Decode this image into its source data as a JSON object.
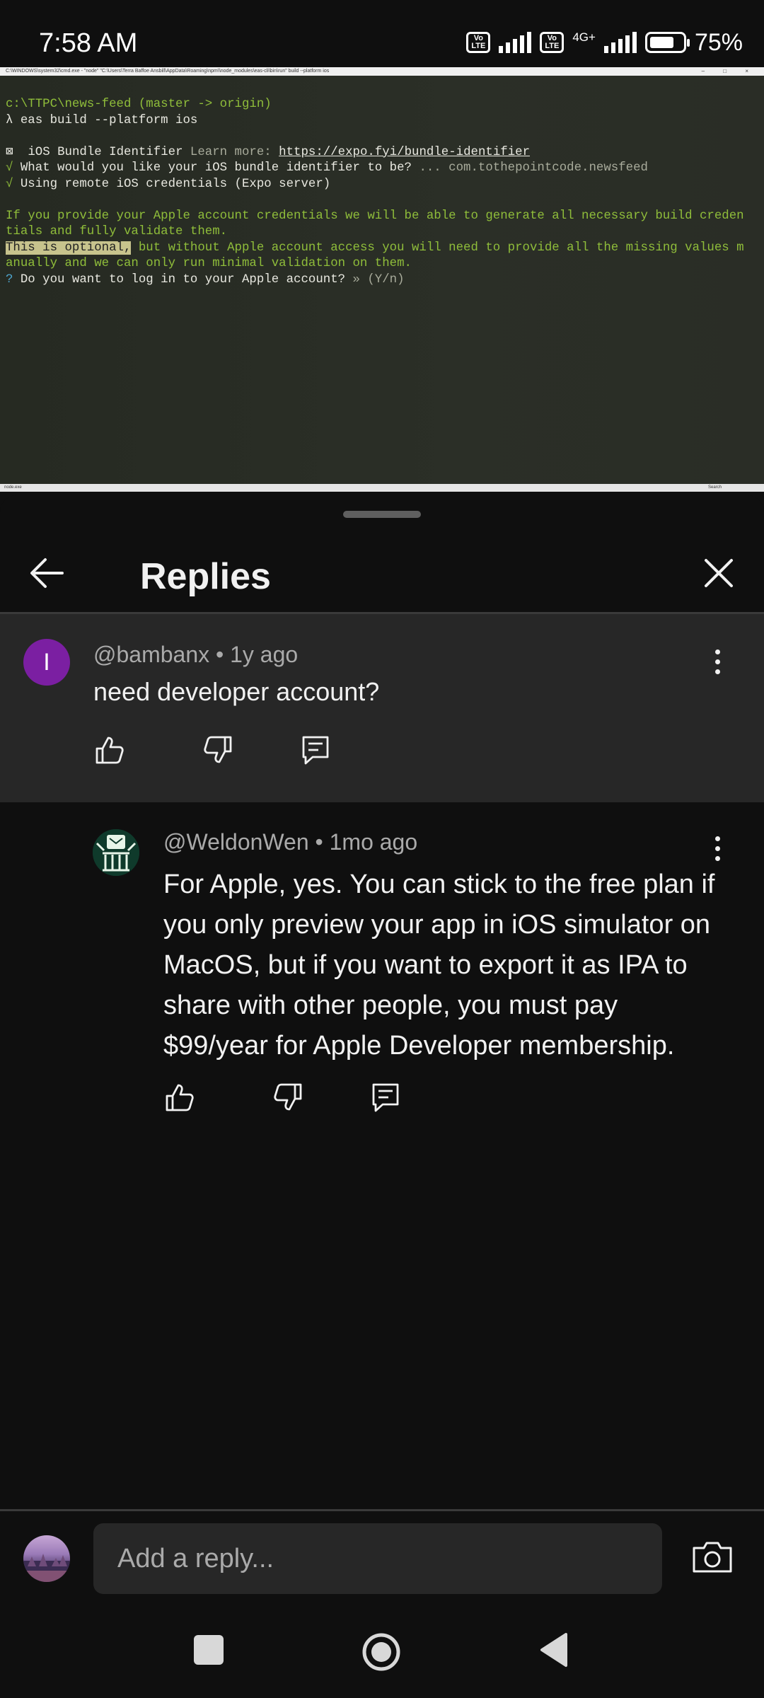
{
  "status_bar": {
    "time": "7:58 AM",
    "volte_1": "Vo LTE",
    "volte_2": "Vo LTE",
    "network": "4G+",
    "battery_percent": 75,
    "battery_text": "75%"
  },
  "terminal": {
    "title": "C:\\WINDOWS\\system32\\cmd.exe - \"node\" \"C:\\Users\\Terra Baffoe Ansbill\\AppData\\Roaming\\npm\\\\node_modules\\eas-cli\\bin\\run\" build --platform ios",
    "window_controls": "– □ ×",
    "prompt_path": "c:\\TTPC\\news-feed (master -> origin)",
    "command": "λ eas build --platform ios",
    "bundle_label": "⊠  iOS Bundle Identifier",
    "learn_more": " Learn more: ",
    "learn_more_link": "https://expo.fyi/bundle-identifier",
    "q1_check": "√",
    "q1_text": " What would you like your iOS bundle identifier to be? ",
    "q1_answer": "... com.tothepointcode.newsfeed",
    "q2_check": "√",
    "q2_text": " Using remote iOS credentials (Expo server)",
    "info_line1": "If you provide your Apple account credentials we will be able to generate all necessary build creden",
    "info_line2": "tials and fully validate them.",
    "optional_hl": "This is optional,",
    "optional_rest": " but without Apple account access you will need to provide all the missing values m",
    "optional_line2": "anually and we can only run minimal validation on them.",
    "q3_mark": "?",
    "q3_text": " Do you want to log in to your Apple account? ",
    "q3_hint": "» (Y/n)",
    "statusbar_left": "node.exe",
    "statusbar_search": "Search"
  },
  "sheet": {
    "title": "Replies"
  },
  "parent_comment": {
    "avatar_letter": "I",
    "author": "@bambanx",
    "separator": " • ",
    "time": "1y ago",
    "text": "need developer account?"
  },
  "reply_comment": {
    "author": "@WeldonWen",
    "separator": " • ",
    "time": "1mo ago",
    "text": "For Apple, yes. You can stick to the free plan if you only preview your app in iOS simulator on MacOS, but if you want to export it as IPA to share with other people, you must pay $99/year for Apple Developer membership."
  },
  "composer": {
    "placeholder": "Add a reply..."
  },
  "icons": {
    "back": "arrow-left-icon",
    "close": "close-icon",
    "like": "thumbs-up-icon",
    "dislike": "thumbs-down-icon",
    "reply": "comment-icon",
    "more": "kebab-icon",
    "camera": "camera-icon"
  },
  "colors": {
    "background": "#0f0f0f",
    "parent_highlight": "#272727",
    "avatar_purple": "#7b1fa2",
    "terminal_green": "#8fbd3a"
  }
}
